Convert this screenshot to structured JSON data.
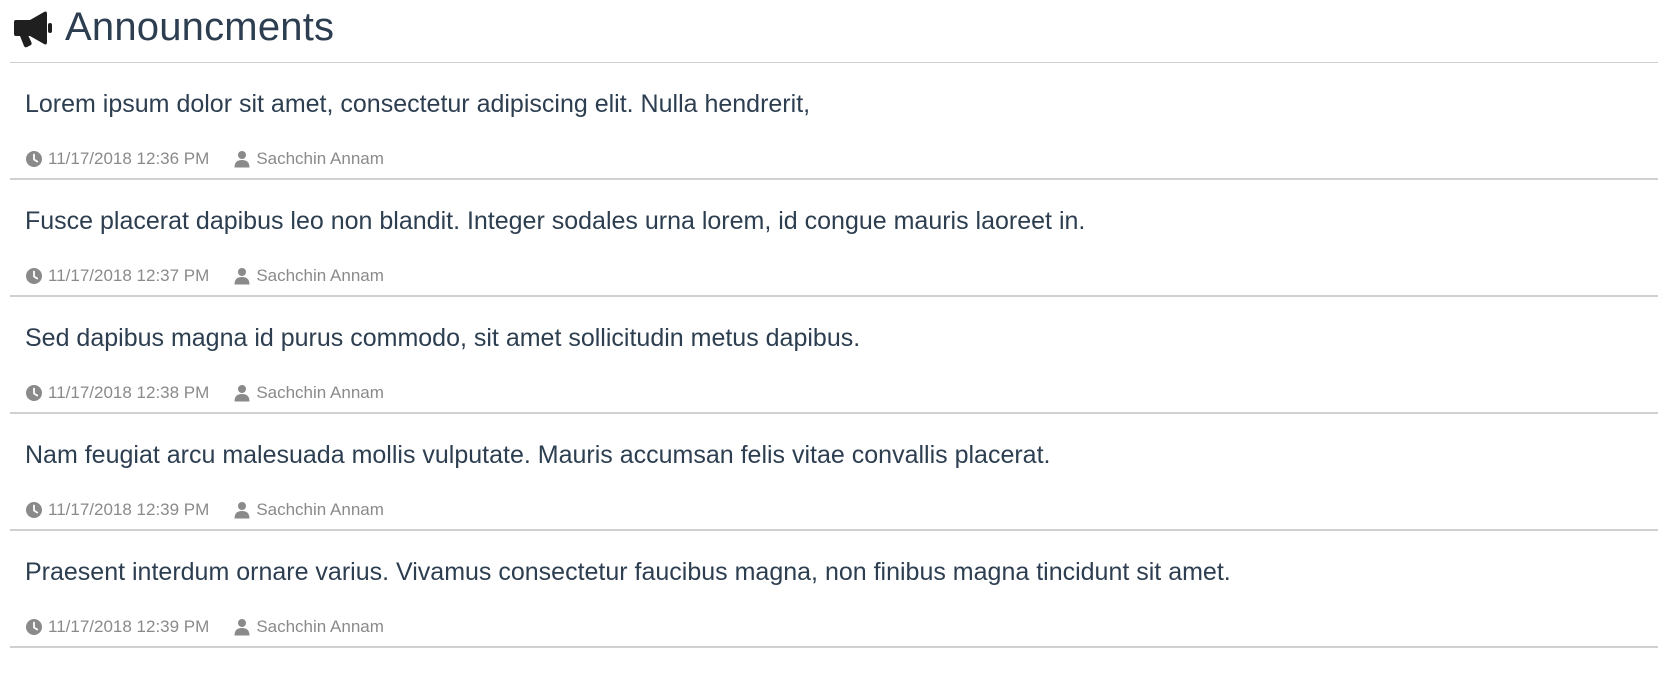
{
  "header": {
    "title": "Announcments",
    "icon": "megaphone-icon"
  },
  "colors": {
    "text": "#2c3e50",
    "meta": "#8a8a8a",
    "divider": "#d0d0d0"
  },
  "announcements": [
    {
      "text": "Lorem ipsum dolor sit amet, consectetur adipiscing elit. Nulla hendrerit,",
      "datetime": "11/17/2018 12:36 PM",
      "author": "Sachchin Annam"
    },
    {
      "text": "Fusce placerat dapibus leo non blandit. Integer sodales urna lorem, id congue mauris laoreet in.",
      "datetime": "11/17/2018 12:37 PM",
      "author": "Sachchin Annam"
    },
    {
      "text": "Sed dapibus magna id purus commodo, sit amet sollicitudin metus dapibus.",
      "datetime": "11/17/2018 12:38 PM",
      "author": "Sachchin Annam"
    },
    {
      "text": "Nam feugiat arcu malesuada mollis vulputate. Mauris accumsan felis vitae convallis placerat.",
      "datetime": "11/17/2018 12:39 PM",
      "author": "Sachchin Annam"
    },
    {
      "text": "Praesent interdum ornare varius. Vivamus consectetur faucibus magna, non finibus magna tincidunt sit amet.",
      "datetime": "11/17/2018 12:39 PM",
      "author": "Sachchin Annam"
    }
  ]
}
